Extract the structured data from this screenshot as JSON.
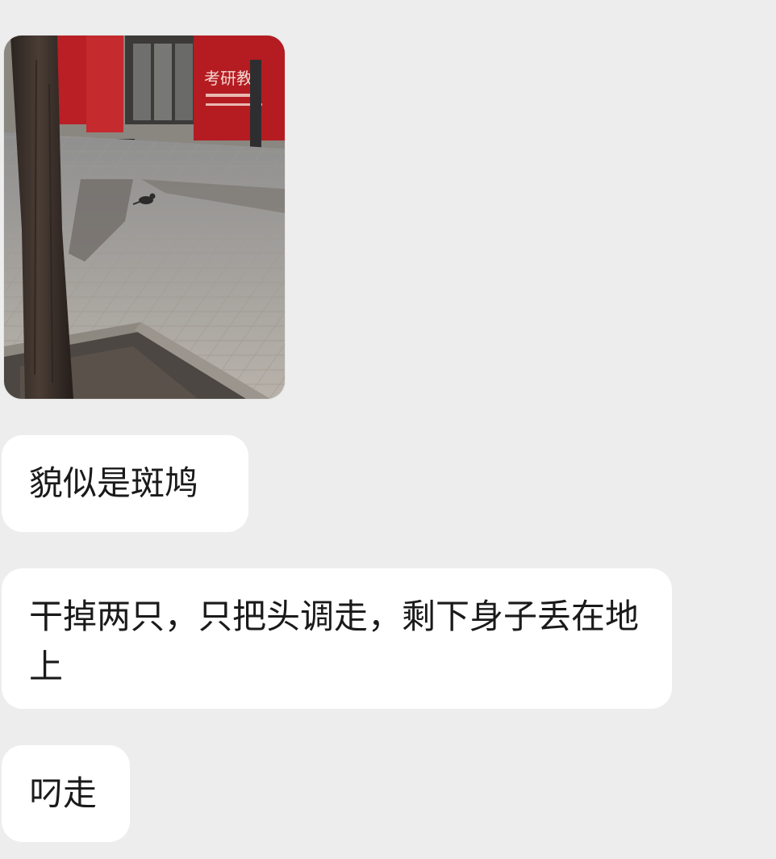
{
  "chat": {
    "messages": [
      {
        "type": "image",
        "alt": "",
        "sign_text": "考研教"
      },
      {
        "type": "text",
        "text": "貌似是斑鸠"
      },
      {
        "type": "text",
        "text": "干掉两只，只把头调走，剩下身子丢在地上"
      },
      {
        "type": "text",
        "text": "叼走"
      }
    ]
  },
  "colors": {
    "background": "#ededed",
    "bubble": "#ffffff",
    "text": "#1a1a1a",
    "sign_red": "#b91f25"
  }
}
